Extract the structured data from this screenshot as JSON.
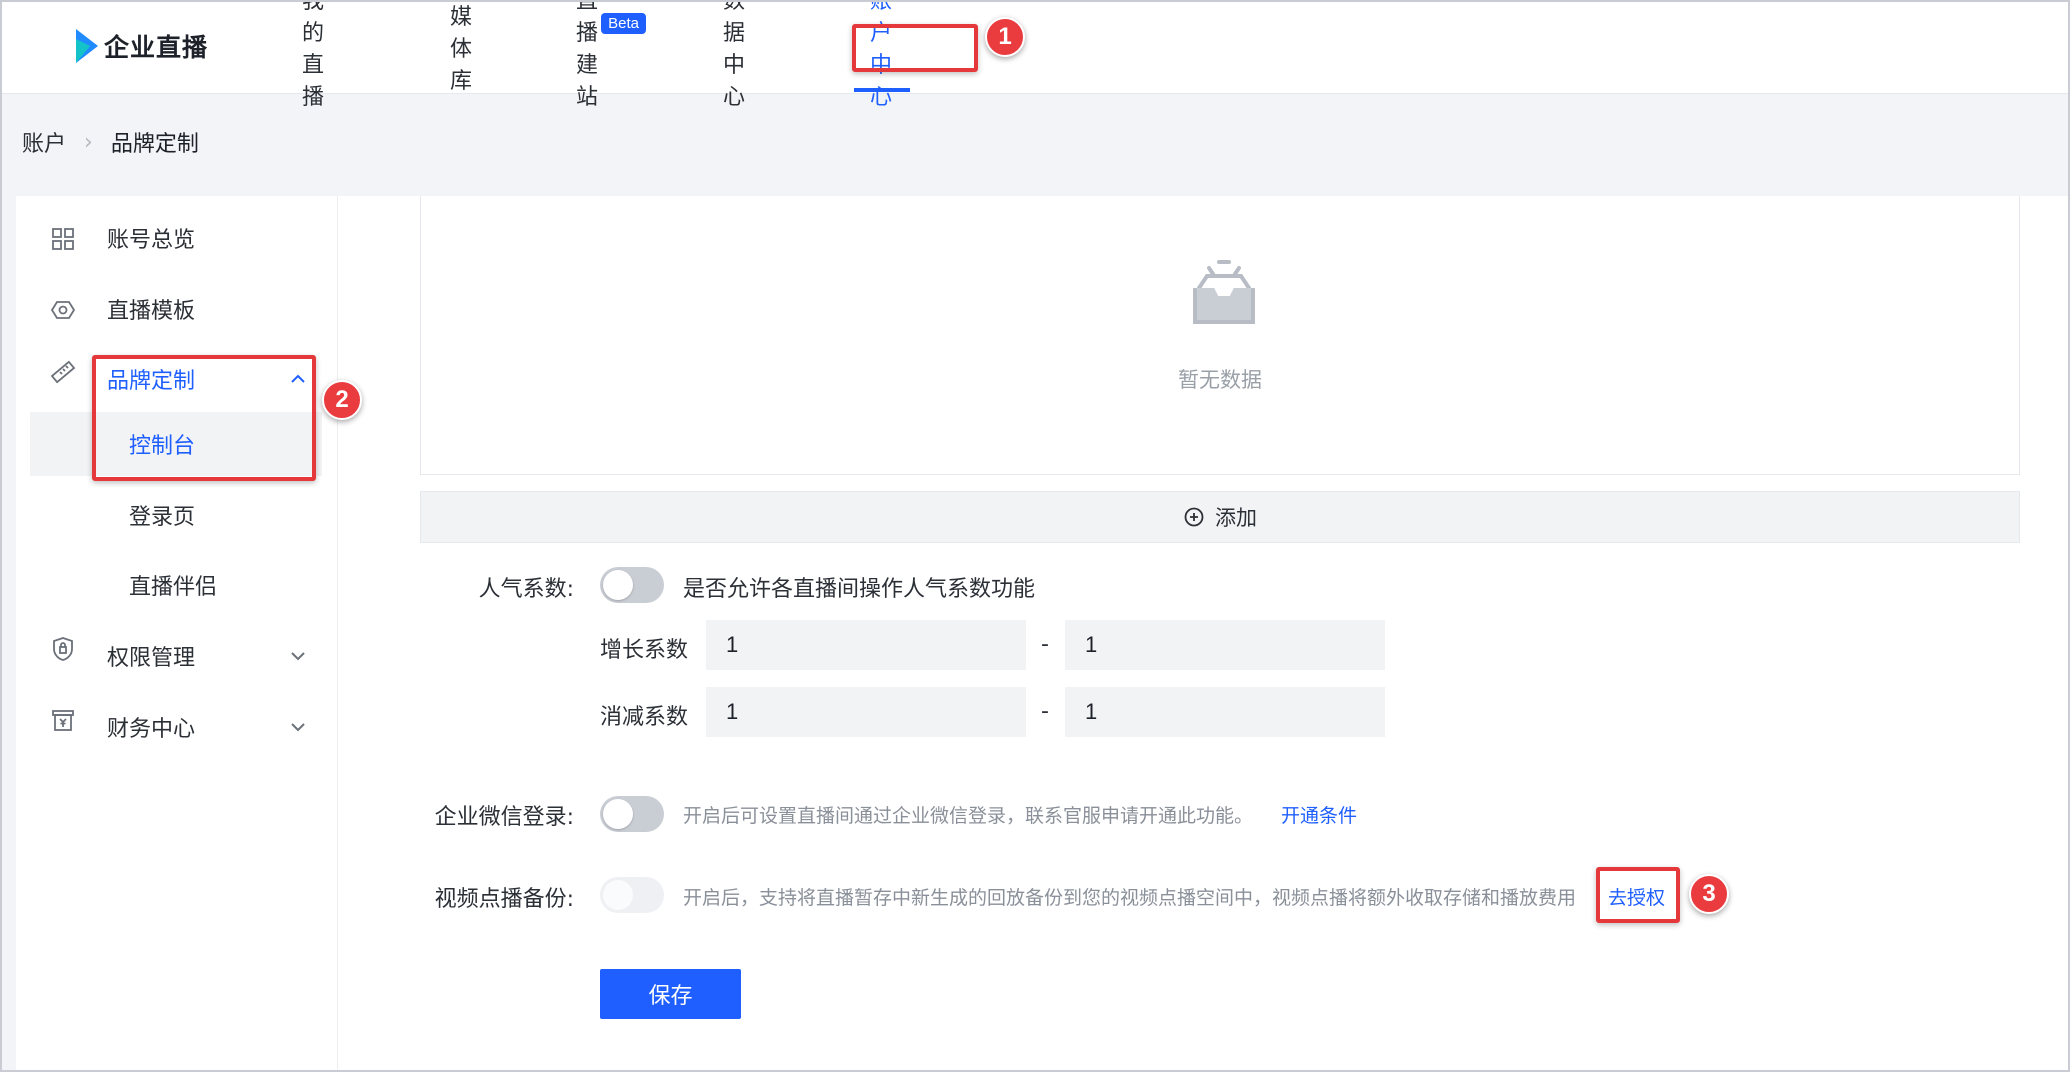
{
  "app": {
    "logo_text": "企业直播"
  },
  "nav": {
    "items": [
      {
        "label": "我的直播"
      },
      {
        "label": "媒体库"
      },
      {
        "label": "直播建站",
        "badge": "Beta"
      },
      {
        "label": "数据中心"
      },
      {
        "label": "账户中心",
        "active": true
      }
    ]
  },
  "breadcrumb": {
    "root": "账户",
    "current": "品牌定制"
  },
  "sidebar": {
    "items": [
      {
        "label": "账号总览",
        "icon": "grid-icon"
      },
      {
        "label": "直播模板",
        "icon": "template-icon"
      },
      {
        "label": "品牌定制",
        "icon": "ruler-icon",
        "open": true,
        "children": [
          {
            "label": "控制台",
            "active": true
          },
          {
            "label": "登录页"
          },
          {
            "label": "直播伴侣"
          }
        ]
      },
      {
        "label": "权限管理",
        "icon": "shield-lock-icon"
      },
      {
        "label": "财务中心",
        "icon": "wallet-icon"
      }
    ]
  },
  "main": {
    "empty_text": "暂无数据",
    "add_label": "添加",
    "popularity": {
      "label": "人气系数:",
      "switch_text": "是否允许各直播间操作人气系数功能",
      "growth_label": "增长系数",
      "growth_min": "1",
      "growth_max": "1",
      "decay_label": "消减系数",
      "decay_min": "1",
      "decay_max": "1",
      "range_sep": "-"
    },
    "wecom": {
      "label": "企业微信登录:",
      "hint": "开启后可设置直播间通过企业微信登录，联系官服申请开通此功能。",
      "link": "开通条件"
    },
    "vod": {
      "label": "视频点播备份:",
      "hint": "开启后，支持将直播暂存中新生成的回放备份到您的视频点播空间中，视频点播将额外收取存储和播放费用",
      "link": "去授权"
    },
    "save_label": "保存"
  },
  "annotations": [
    "1",
    "2",
    "3"
  ],
  "colors": {
    "accent": "#1f5fff",
    "callout": "#e5383b"
  }
}
